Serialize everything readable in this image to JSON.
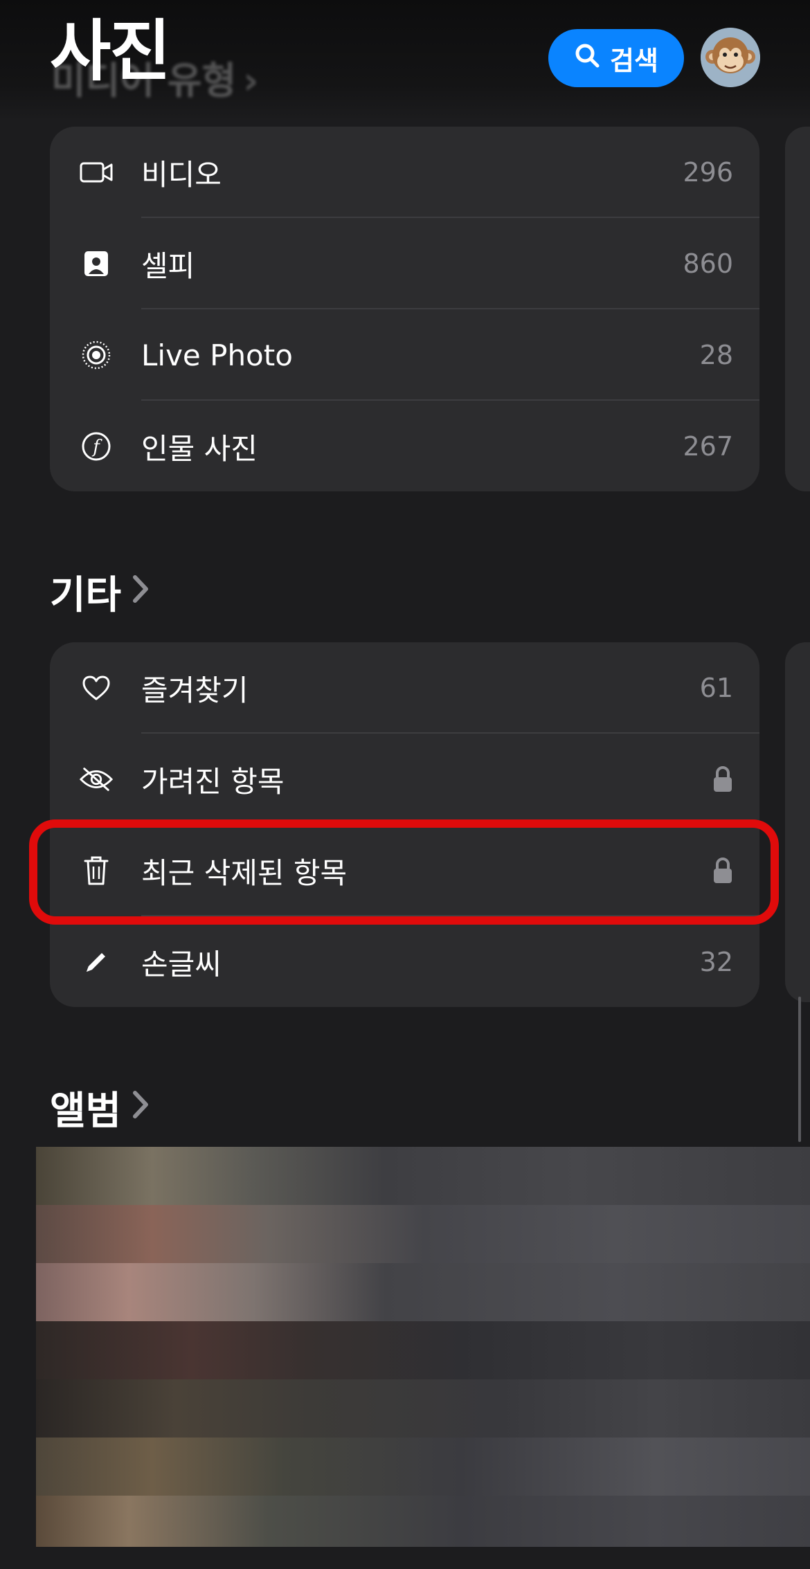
{
  "header": {
    "title": "사진",
    "ghost_section": "미디어 유형",
    "search_label": "검색",
    "avatar_emoji": "🐵"
  },
  "media_types": {
    "items": [
      {
        "icon": "video-icon",
        "label": "비디오",
        "count": "296"
      },
      {
        "icon": "selfie-icon",
        "label": "셀피",
        "count": "860"
      },
      {
        "icon": "live-photo-icon",
        "label": "Live Photo",
        "count": "28"
      },
      {
        "icon": "portrait-icon",
        "label": "인물 사진",
        "count": "267"
      }
    ]
  },
  "other": {
    "title": "기타",
    "items": [
      {
        "icon": "heart-icon",
        "label": "즐겨찾기",
        "count": "61"
      },
      {
        "icon": "eye-slash-icon",
        "label": "가려진 항목",
        "locked": true
      },
      {
        "icon": "trash-icon",
        "label": "최근 삭제된 항목",
        "locked": true,
        "highlighted": true
      },
      {
        "icon": "pencil-icon",
        "label": "손글씨",
        "count": "32"
      }
    ]
  },
  "albums": {
    "title": "앨범"
  },
  "colors": {
    "background": "#1c1c1e",
    "card": "#2c2c2e",
    "accent": "#0a84ff",
    "highlight": "#e00b0b",
    "secondary_text": "#8e8e93"
  }
}
